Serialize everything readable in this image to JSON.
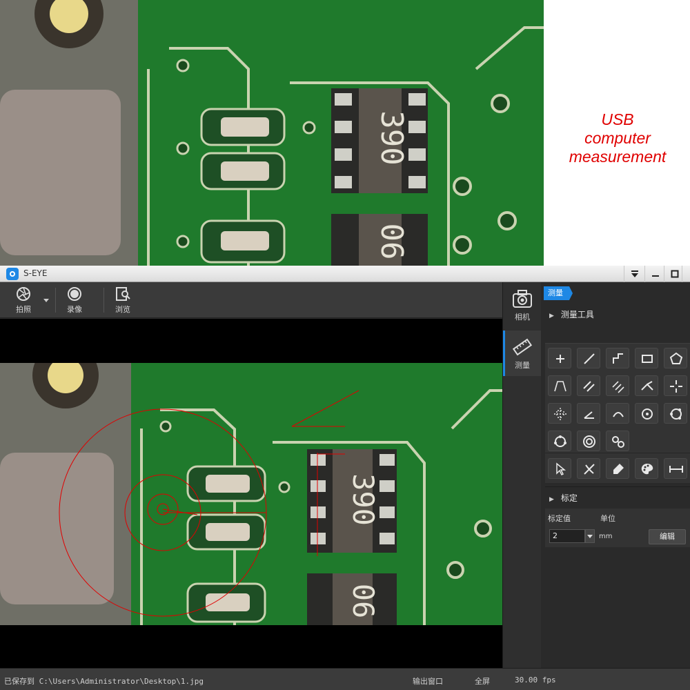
{
  "promo": {
    "caption_lines": [
      "USB",
      "computer",
      "measurement"
    ]
  },
  "app": {
    "title": "S-EYE",
    "toolbar": {
      "capture_label": "拍照",
      "record_label": "录像",
      "browse_label": "浏览"
    },
    "sidetabs": {
      "camera_label": "相机",
      "measure_label": "测量"
    },
    "panel": {
      "active_tab": "测量",
      "tools_section": "测量工具",
      "calibration_section": "标定",
      "calib_value_label": "标定值",
      "unit_label": "单位",
      "calib_value": "2",
      "unit_value": "mm",
      "edit_button": "编辑"
    },
    "status": {
      "saved_path": "已保存到 C:\\Users\\Administrator\\Desktop\\1.jpg",
      "output_window": "输出窗口",
      "fullscreen": "全屏",
      "fps": "30.00 fps"
    },
    "accent_color": "#1e88e5",
    "measure_color": "#e00000"
  },
  "tools": [
    {
      "name": "point-tool-icon"
    },
    {
      "name": "line-tool-icon"
    },
    {
      "name": "polyline-tool-icon"
    },
    {
      "name": "rectangle-tool-icon"
    },
    {
      "name": "polygon-tool-icon"
    },
    {
      "name": "triangle-tool-icon"
    },
    {
      "name": "parallel-lines-tool-icon"
    },
    {
      "name": "multi-line-tool-icon"
    },
    {
      "name": "angle-vertex-tool-icon"
    },
    {
      "name": "crosshair-tool-icon"
    },
    {
      "name": "grid-cross-tool-icon"
    },
    {
      "name": "angle-tool-icon"
    },
    {
      "name": "arc-tool-icon"
    },
    {
      "name": "circle-center-tool-icon"
    },
    {
      "name": "circle-three-point-tool-icon"
    },
    {
      "name": "circle-points-tool-icon"
    },
    {
      "name": "concentric-circles-tool-icon"
    },
    {
      "name": "two-circles-tool-icon"
    },
    {
      "name": "select-tool-icon"
    },
    {
      "name": "delete-tool-icon"
    },
    {
      "name": "clear-tool-icon"
    },
    {
      "name": "color-palette-icon"
    },
    {
      "name": "scale-bar-icon"
    }
  ]
}
